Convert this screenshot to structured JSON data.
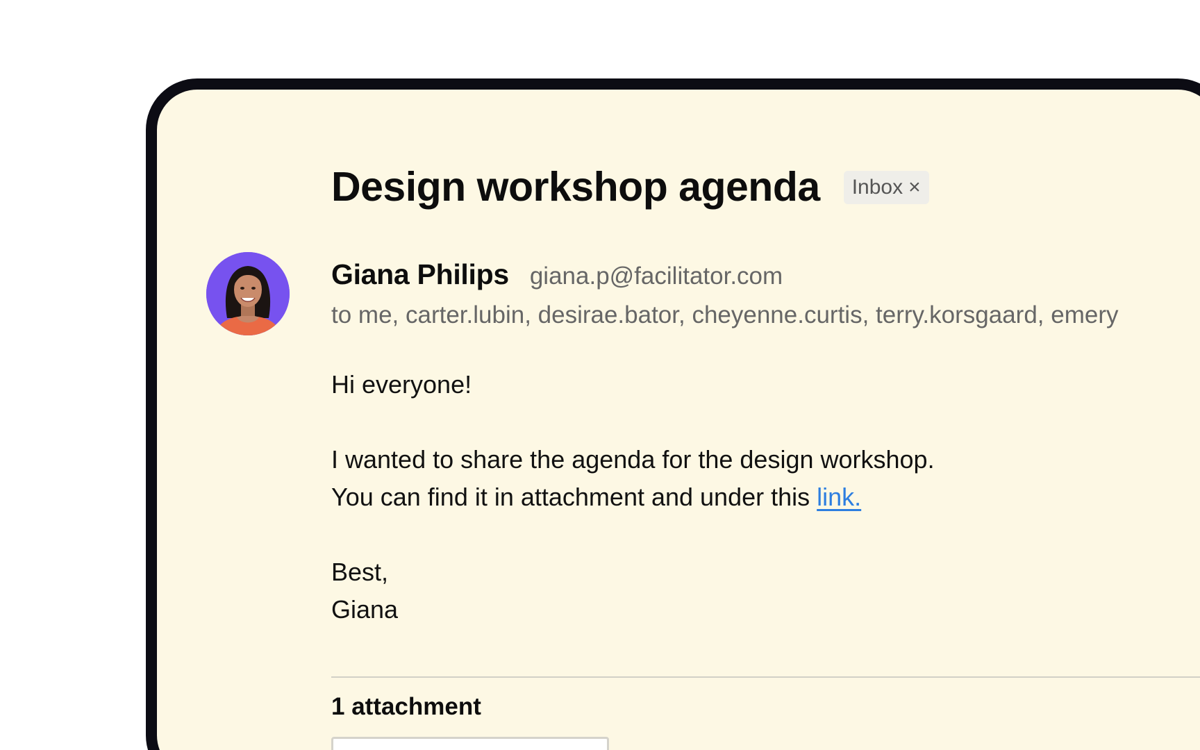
{
  "email": {
    "subject": "Design workshop agenda",
    "label": {
      "text": "Inbox",
      "remove_glyph": "×"
    },
    "sender": {
      "name": "Giana Philips",
      "email": "giana.p@facilitator.com",
      "avatar_icon": "avatar-photo"
    },
    "recipients": "to me, carter.lubin, desirae.bator, cheyenne.curtis, terry.korsgaard, emery",
    "body": {
      "greeting": "Hi everyone!",
      "line1": "I wanted to share the agenda for the design workshop.",
      "line2_prefix": "You can find it in attachment and under this ",
      "link_text": "link.",
      "signoff": "Best,",
      "signature": "Giana"
    },
    "attachments": {
      "heading": "1 attachment"
    }
  },
  "colors": {
    "background": "#fdf8e4",
    "frame": "#0c0c14",
    "link": "#2d7ee0",
    "avatar_bg": "#7752ef"
  }
}
